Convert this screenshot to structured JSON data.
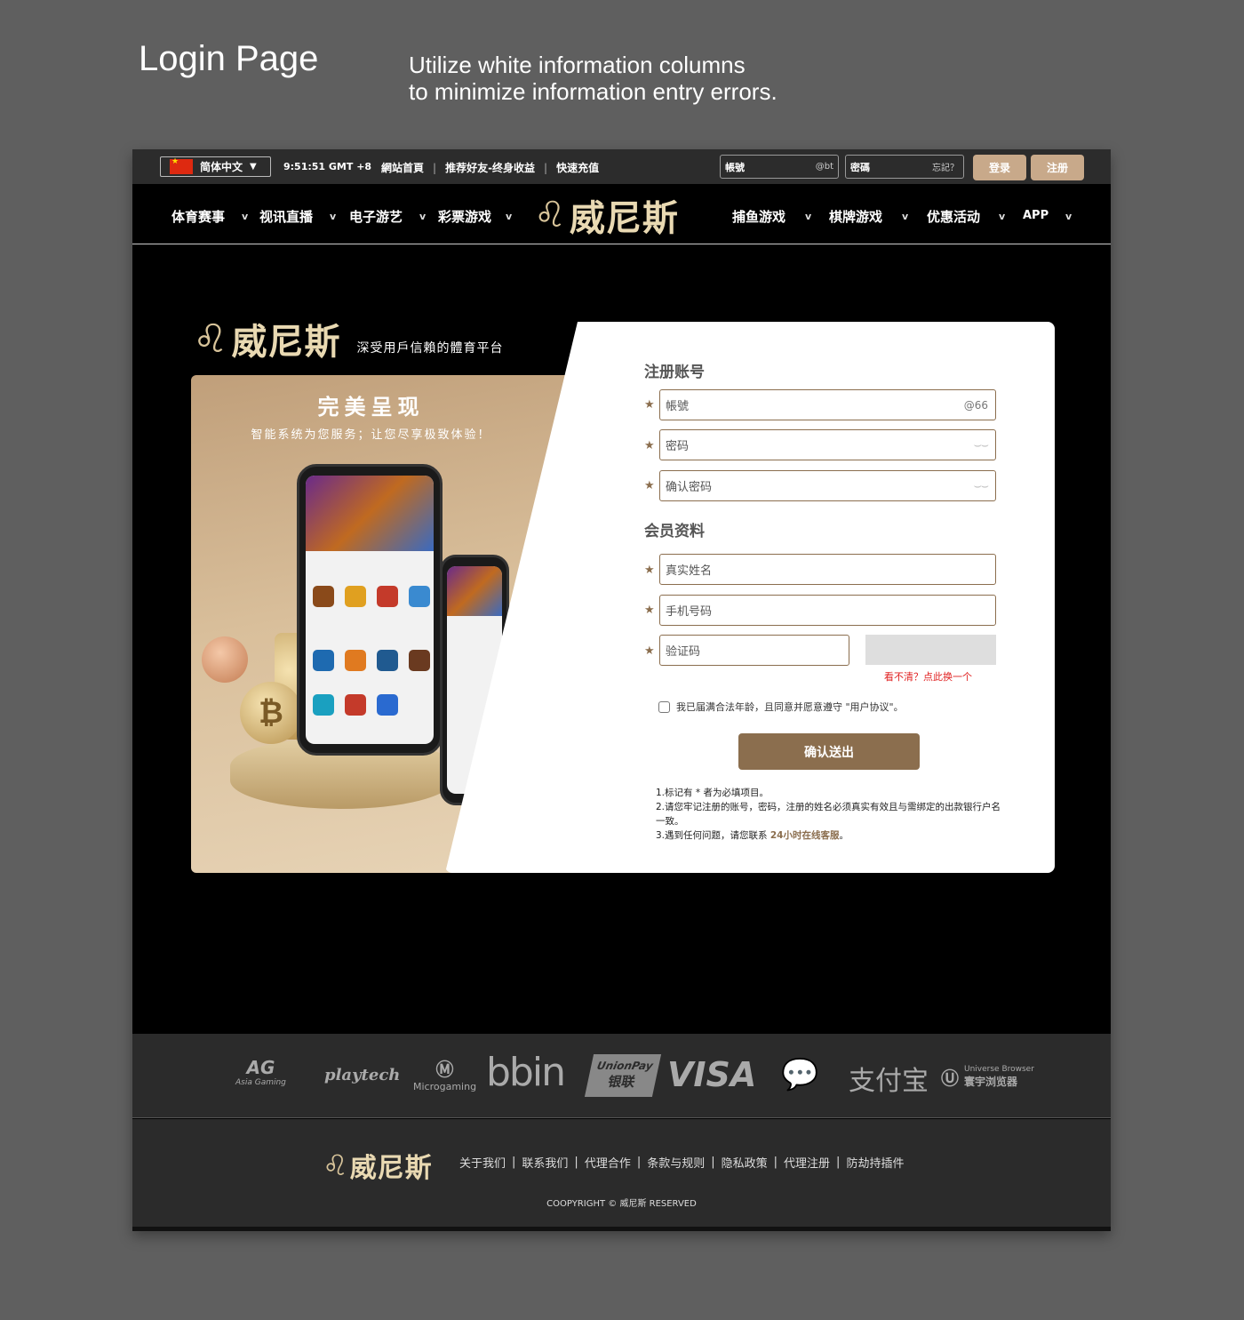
{
  "presentation": {
    "title": "Login Page",
    "subtitle_line1": "Utilize white information columns",
    "subtitle_line2": "to minimize information entry errors."
  },
  "topbar": {
    "language": "简体中文",
    "time": "9:51:51 GMT +8",
    "links": [
      "網站首頁",
      "推荐好友-终身收益",
      "快速充值"
    ],
    "account_placeholder": "帳號",
    "account_suffix": "@bt",
    "password_placeholder": "密碼",
    "forgot": "忘記？",
    "login_label": "登录",
    "register_label": "注册"
  },
  "nav": {
    "left_items": [
      "体育赛事",
      "视讯直播",
      "电子游艺",
      "彩票游戏"
    ],
    "right_items": [
      "捕鱼游戏",
      "棋牌游戏",
      "优惠活动",
      "APP"
    ],
    "caret": "v",
    "logo_text": "威尼斯"
  },
  "brand": {
    "logo_text": "威尼斯",
    "slogan": "深受用戶信賴的體育平台"
  },
  "promo": {
    "headline": "完美呈现",
    "subline": "智能系统为您服务；让您尽享极致体验！",
    "coin_symbol": "₿"
  },
  "form": {
    "section_account": "注册账号",
    "account_placeholder": "帳號",
    "account_suffix": "@66",
    "password_placeholder": "密码",
    "confirm_password_placeholder": "确认密码",
    "section_member": "会员资料",
    "real_name_placeholder": "真实姓名",
    "phone_placeholder": "手机号码",
    "captcha_placeholder": "验证码",
    "captcha_refresh": "看不清？点此换一个",
    "agree_text": "我已届满合法年龄，且同意并愿意遵守 \"用户协议\"。",
    "submit_label": "确认送出",
    "required_mark": "★",
    "note1": "1.标记有 * 者为必填项目。",
    "note2": "2.请您牢记注册的账号，密码，注册的姓名必须真实有效且与需绑定的出款银行户名一致。",
    "note3_prefix": "3.遇到任何问题，请您联系 ",
    "note3_link": "24小时在线客服",
    "note3_suffix": "。"
  },
  "partners": {
    "ag": "AG",
    "ag_sub": "Asia Gaming",
    "playtech": "playtech",
    "microgaming": "Microgaming",
    "bbin": "bbin",
    "unionpay": "UnionPay",
    "unionpay_cn": "银联",
    "visa": "VISA",
    "alipay": "支付宝",
    "universe_en": "Universe Browser",
    "universe_cn": "寰宇浏览器"
  },
  "footer": {
    "logo_text": "威尼斯",
    "links": [
      "关于我们",
      "联系我们",
      "代理合作",
      "条款与规则",
      "隐私政策",
      "代理注册",
      "防劫持插件"
    ],
    "copyright": "COOPYRIGHT © 威尼斯 RESERVED"
  },
  "colors": {
    "accent_brown": "#8b6e4e",
    "button_tan": "#c8a98a",
    "logo_gold": "#e9d9b2",
    "error_red": "#e02020"
  }
}
